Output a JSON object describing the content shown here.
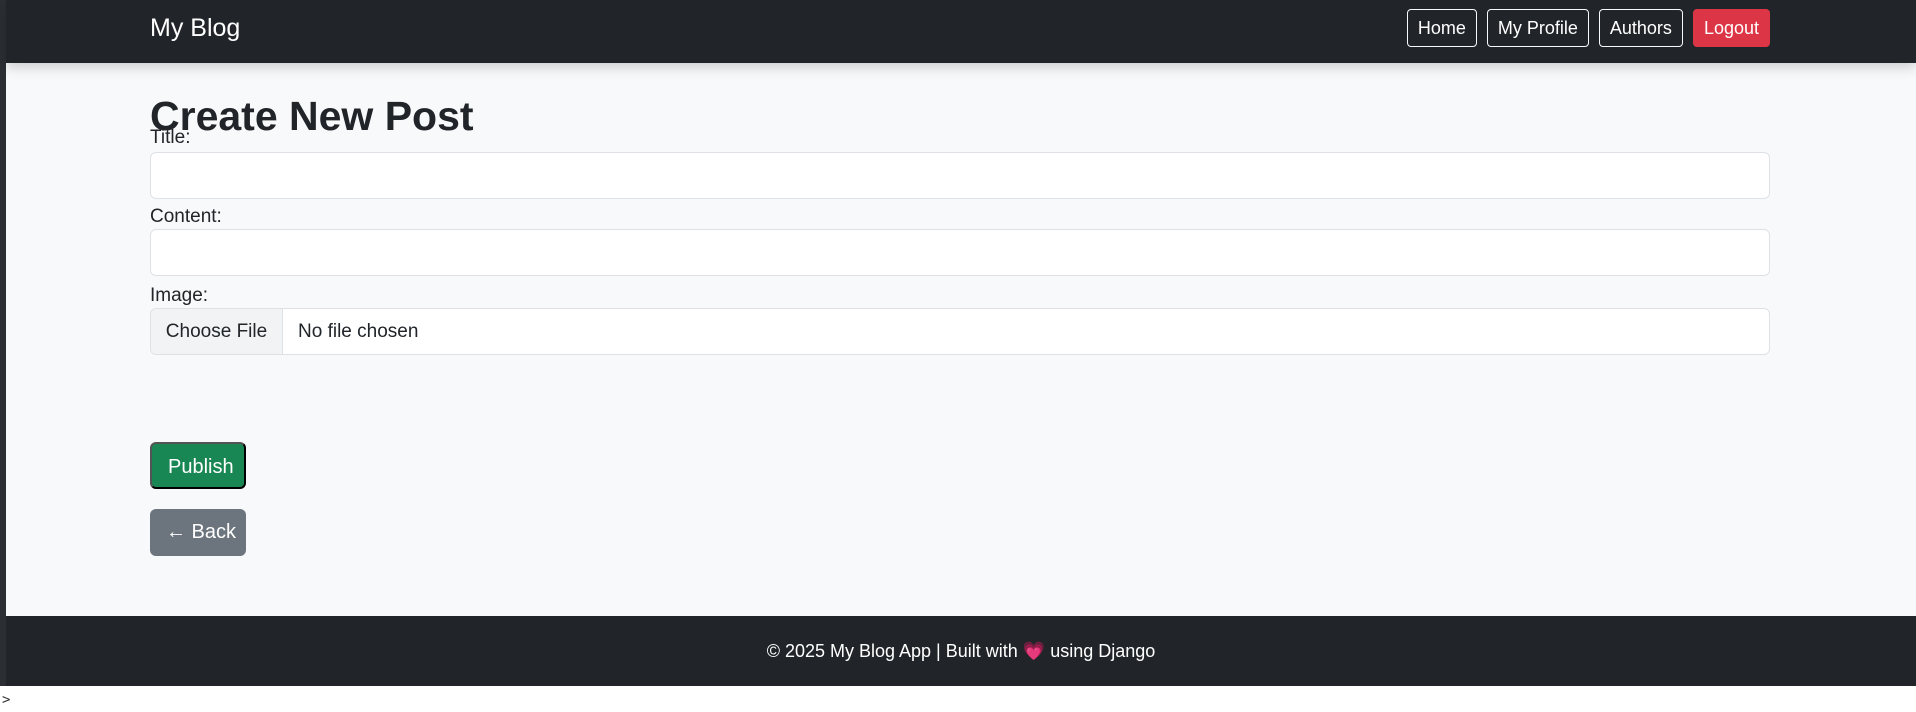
{
  "navbar": {
    "brand": "My Blog",
    "links": [
      {
        "label": "Home"
      },
      {
        "label": "My Profile"
      },
      {
        "label": "Authors"
      },
      {
        "label": "Logout"
      }
    ]
  },
  "form": {
    "heading": "Create New Post",
    "title_label": "Title:",
    "title_value": "",
    "content_label": "Content:",
    "content_value": "",
    "image_label": "Image:",
    "file_button": "Choose File",
    "file_status": "No file chosen",
    "publish_label": "Publish",
    "back_label": "← Back"
  },
  "footer": {
    "text_before": "© 2025 My Blog App | Built with",
    "heart": "💗",
    "text_after": "using Django"
  },
  "terminal_prompt": ">",
  "colors": {
    "navbar_bg": "#212529",
    "danger": "#dc3545",
    "success": "#198754",
    "secondary": "#6c757d",
    "page_bg": "#f8f9fa"
  }
}
